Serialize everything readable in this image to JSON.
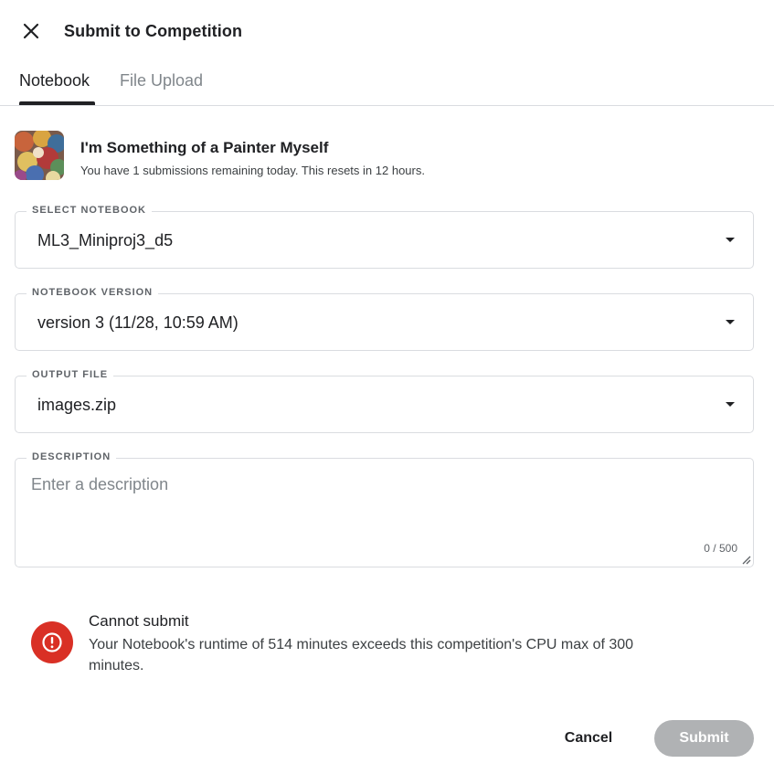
{
  "dialog": {
    "title": "Submit to Competition",
    "close_icon": "close-icon"
  },
  "tabs": [
    {
      "label": "Notebook",
      "active": true
    },
    {
      "label": "File Upload",
      "active": false
    }
  ],
  "competition": {
    "name": "I'm Something of a Painter Myself",
    "subtitle": "You have 1 submissions remaining today. This resets in 12 hours."
  },
  "fields": {
    "notebook": {
      "label": "SELECT NOTEBOOK",
      "value": "ML3_Miniproj3_d5"
    },
    "version": {
      "label": "NOTEBOOK VERSION",
      "value": "version 3 (11/28, 10:59 AM)"
    },
    "output": {
      "label": "OUTPUT FILE",
      "value": "images.zip"
    },
    "description": {
      "label": "DESCRIPTION",
      "placeholder": "Enter a description",
      "count": "0 / 500"
    }
  },
  "error": {
    "title": "Cannot submit",
    "message": "Your Notebook's runtime of 514 minutes exceeds this competition's CPU max of 300 minutes.",
    "color": "#d93025"
  },
  "actions": {
    "cancel": "Cancel",
    "submit": "Submit"
  }
}
